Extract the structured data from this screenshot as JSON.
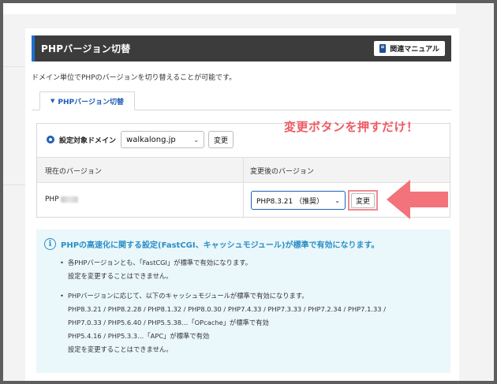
{
  "header": {
    "title": "PHPバージョン切替",
    "manual_button": "関連マニュアル"
  },
  "description": "ドメイン単位でPHPのバージョンを切り替えることが可能です。",
  "tab": {
    "label": "PHPバージョン切替"
  },
  "target": {
    "label": "設定対象ドメイン",
    "domain": "walkalong.jp",
    "change_button": "変更"
  },
  "table": {
    "col_current": "現在のバージョン",
    "col_new": "変更後のバージョン",
    "current_version_prefix": "PHP",
    "new_version": "PHP8.3.21 （推奨）",
    "change_button": "変更"
  },
  "annotation": {
    "text": "変更ボタンを押すだけ！",
    "color": "#ee5a62"
  },
  "info": {
    "title": "PHPの高速化に関する設定(FastCGI、キャッシュモジュール)が標準で有効になります。",
    "item1_line1": "各PHPバージョンとも、「FastCGI」が標準で有効になります。",
    "item1_line2": "設定を変更することはできません。",
    "item2_line1": "PHPバージョンに応じて、以下のキャッシュモジュールが標準で有効になります。",
    "item2_line2": "PHP8.3.21 / PHP8.2.28 / PHP8.1.32 / PHP8.0.30 / PHP7.4.33 / PHP7.3.33 / PHP7.2.34 / PHP7.1.33 /",
    "item2_line3": "PHP7.0.33 / PHP5.6.40 / PHP5.5.38…「OPcache」が標準で有効",
    "item2_line4": "PHP5.4.16 / PHP5.3.3…「APC」が標準で有効",
    "item2_line5": "設定を変更することはできません。"
  }
}
